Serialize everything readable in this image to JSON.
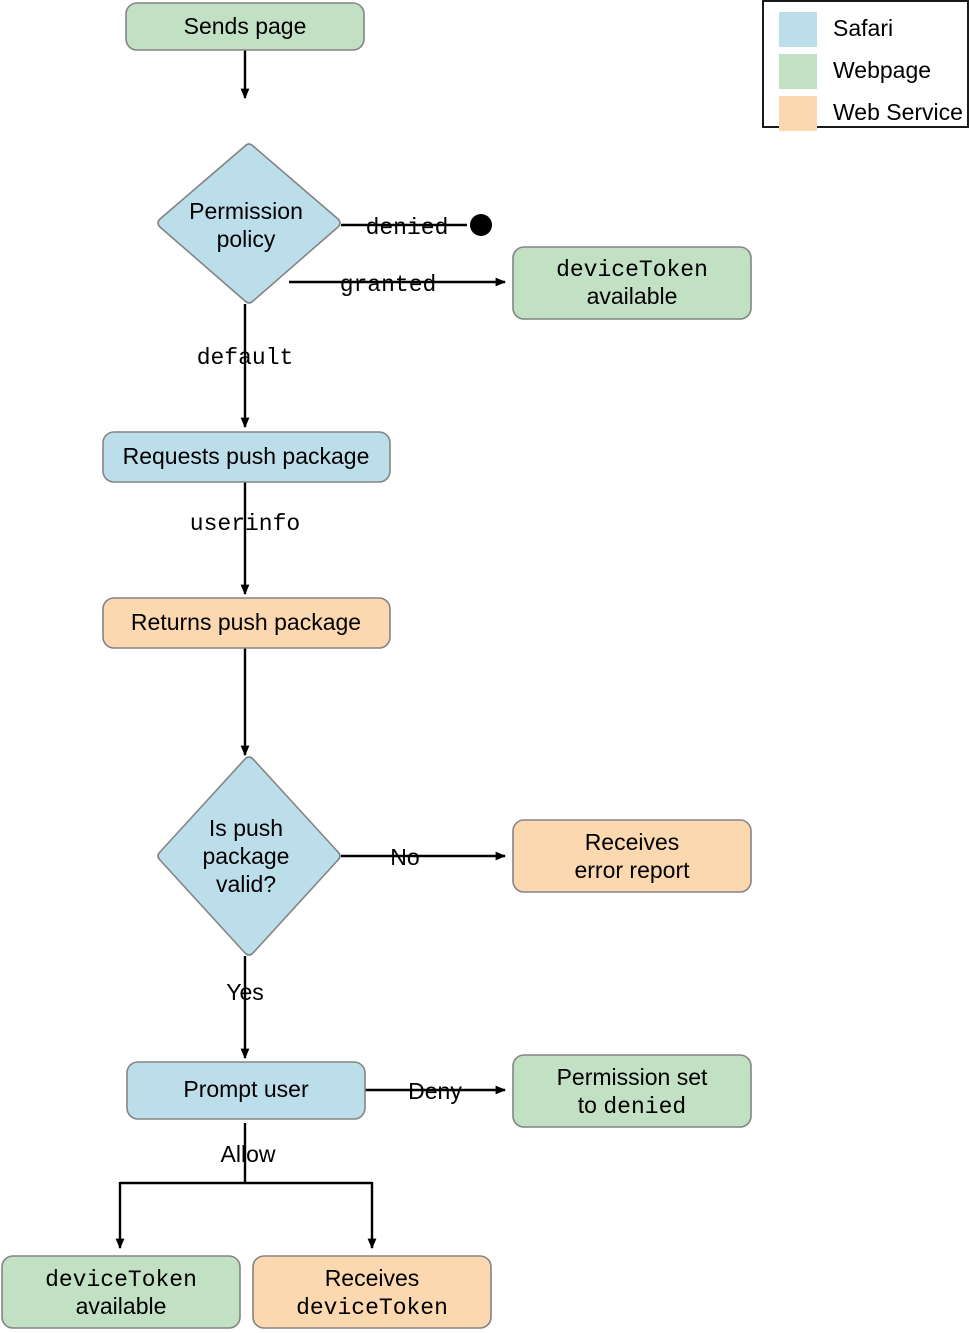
{
  "diagram": {
    "title": "Safari Push Notifications permission flow",
    "colors": {
      "safari": "#bbdeea",
      "webpage": "#c2e0c4",
      "web_service": "#fbd8b0",
      "node_stroke": "#848484",
      "edge": "#000000",
      "background": "#ffffff"
    },
    "legend": {
      "items": [
        {
          "label": "Safari",
          "color": "#bbdeea"
        },
        {
          "label": "Webpage",
          "color": "#c2e0c4"
        },
        {
          "label": "Web Service",
          "color": "#fbd8b0"
        }
      ]
    },
    "nodes": [
      {
        "id": "sends-page",
        "shape": "rounded-rect",
        "actor": "Webpage",
        "color": "#c2e0c4",
        "lines": [
          {
            "text": "Sends page",
            "mono": false
          }
        ]
      },
      {
        "id": "permission-policy",
        "shape": "diamond",
        "actor": "Safari",
        "color": "#bbdeea",
        "lines": [
          {
            "text": "Permission",
            "mono": false
          },
          {
            "text": "policy",
            "mono": false
          }
        ]
      },
      {
        "id": "device-token-available-top",
        "shape": "rounded-rect",
        "actor": "Webpage",
        "color": "#c2e0c4",
        "lines": [
          {
            "text": "deviceToken",
            "mono": true
          },
          {
            "text": "available",
            "mono": false
          }
        ]
      },
      {
        "id": "requests-push-package",
        "shape": "rounded-rect",
        "actor": "Safari",
        "color": "#bbdeea",
        "lines": [
          {
            "text": "Requests push package",
            "mono": false
          }
        ]
      },
      {
        "id": "returns-push-package",
        "shape": "rounded-rect",
        "actor": "Web Service",
        "color": "#fbd8b0",
        "lines": [
          {
            "text": "Returns push package",
            "mono": false
          }
        ]
      },
      {
        "id": "is-push-package-valid",
        "shape": "diamond",
        "actor": "Safari",
        "color": "#bbdeea",
        "lines": [
          {
            "text": "Is push",
            "mono": false
          },
          {
            "text": "package",
            "mono": false
          },
          {
            "text": "valid?",
            "mono": false
          }
        ]
      },
      {
        "id": "receives-error-report",
        "shape": "rounded-rect",
        "actor": "Web Service",
        "color": "#fbd8b0",
        "lines": [
          {
            "text": "Receives",
            "mono": false
          },
          {
            "text": "error report",
            "mono": false
          }
        ]
      },
      {
        "id": "prompt-user",
        "shape": "rounded-rect",
        "actor": "Safari",
        "color": "#bbdeea",
        "lines": [
          {
            "text": "Prompt user",
            "mono": false
          }
        ]
      },
      {
        "id": "permission-set-to-denied",
        "shape": "rounded-rect",
        "actor": "Webpage",
        "color": "#c2e0c4",
        "lines": [
          {
            "text": "Permission set",
            "mono": false
          },
          {
            "text": "to denied",
            "mono": "mixed",
            "parts": [
              {
                "text": "to ",
                "mono": false
              },
              {
                "text": "denied",
                "mono": true
              }
            ]
          }
        ]
      },
      {
        "id": "device-token-available-bottom",
        "shape": "rounded-rect",
        "actor": "Webpage",
        "color": "#c2e0c4",
        "lines": [
          {
            "text": "deviceToken",
            "mono": true
          },
          {
            "text": "available",
            "mono": false
          }
        ]
      },
      {
        "id": "receives-device-token",
        "shape": "rounded-rect",
        "actor": "Web Service",
        "color": "#fbd8b0",
        "lines": [
          {
            "text": "Receives",
            "mono": false
          },
          {
            "text": "deviceToken",
            "mono": true
          }
        ]
      },
      {
        "id": "denied-terminal",
        "shape": "filled-circle",
        "actor": "Safari",
        "color": "#000000",
        "lines": []
      }
    ],
    "edge_labels": {
      "denied": "denied",
      "granted": "granted",
      "default": "default",
      "userinfo": "userinfo",
      "no": "No",
      "yes": "Yes",
      "deny": "Deny",
      "allow": "Allow"
    },
    "edges": [
      {
        "from": "sends-page",
        "to": "permission-policy",
        "label": ""
      },
      {
        "from": "permission-policy",
        "to": "denied-terminal",
        "label": "denied",
        "mono": true
      },
      {
        "from": "permission-policy",
        "to": "device-token-available-top",
        "label": "granted",
        "mono": true
      },
      {
        "from": "permission-policy",
        "to": "requests-push-package",
        "label": "default",
        "mono": true
      },
      {
        "from": "requests-push-package",
        "to": "returns-push-package",
        "label": "userinfo",
        "mono": true
      },
      {
        "from": "returns-push-package",
        "to": "is-push-package-valid",
        "label": ""
      },
      {
        "from": "is-push-package-valid",
        "to": "receives-error-report",
        "label": "No",
        "mono": false
      },
      {
        "from": "is-push-package-valid",
        "to": "prompt-user",
        "label": "Yes",
        "mono": false
      },
      {
        "from": "prompt-user",
        "to": "permission-set-to-denied",
        "label": "Deny",
        "mono": false
      },
      {
        "from": "prompt-user",
        "to": "device-token-available-bottom",
        "label": "Allow",
        "mono": false
      },
      {
        "from": "prompt-user",
        "to": "receives-device-token",
        "label": "Allow",
        "mono": false
      }
    ]
  }
}
